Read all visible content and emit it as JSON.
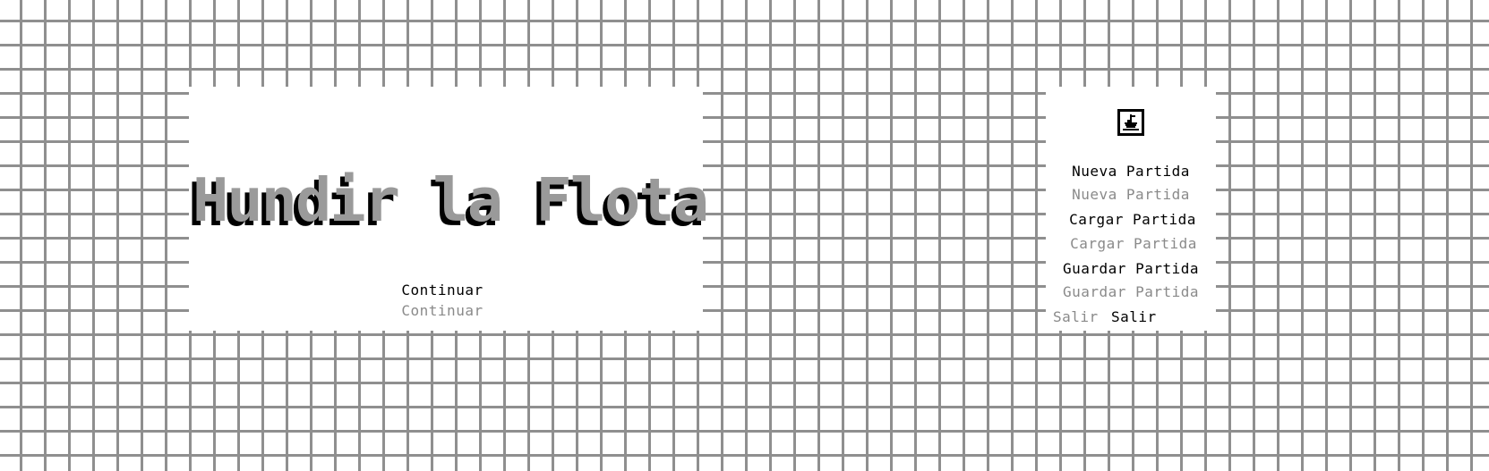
{
  "title_screen": {
    "game_title": "Hundir la Flota",
    "continue_primary": "Continuar",
    "continue_secondary": "Continuar"
  },
  "menu": {
    "icon": "ship-icon",
    "new_game_primary": "Nueva Partida",
    "new_game_secondary": "Nueva Partida",
    "load_game_primary": "Cargar Partida",
    "load_game_secondary": "Cargar Partida",
    "save_game_primary": "Guardar Partida",
    "save_game_secondary": "Guardar Partida",
    "exit_secondary": "Salir",
    "exit_primary": "Salir"
  },
  "colors": {
    "background": "#ffffff",
    "grid_lines": "#8f8f8f",
    "title_fill": "#9a9a9a",
    "title_shadow": "#000000",
    "text_primary": "#000000",
    "text_secondary": "#8a8a8a"
  }
}
